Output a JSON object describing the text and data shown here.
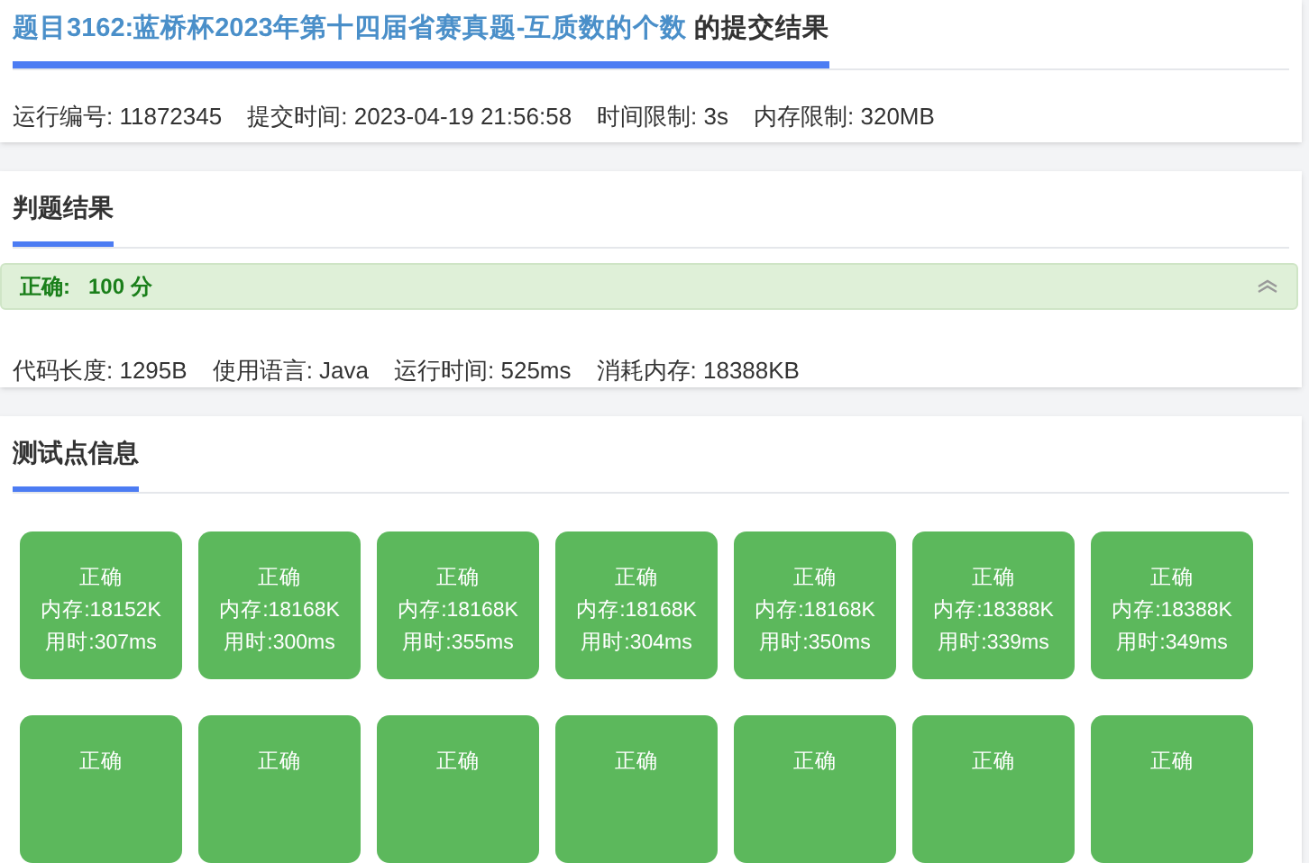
{
  "submission": {
    "problem_title": "题目3162:蓝桥杯2023年第十四届省赛真题-互质数的个数",
    "title_suffix": "的提交结果",
    "info": [
      "运行编号: 11872345",
      "提交时间: 2023-04-19 21:56:58",
      "时间限制: 3s",
      "内存限制: 320MB"
    ]
  },
  "judge": {
    "heading": "判题结果",
    "verdict_label": "正确:",
    "score": "100 分",
    "expanded": true,
    "stats": [
      "代码长度: 1295B",
      "使用语言: Java",
      "运行时间: 525ms",
      "消耗内存: 18388KB"
    ]
  },
  "tests": {
    "heading": "测试点信息",
    "cases": [
      {
        "status": "正确",
        "memory": "内存:18152K",
        "time": "用时:307ms"
      },
      {
        "status": "正确",
        "memory": "内存:18168K",
        "time": "用时:300ms"
      },
      {
        "status": "正确",
        "memory": "内存:18168K",
        "time": "用时:355ms"
      },
      {
        "status": "正确",
        "memory": "内存:18168K",
        "time": "用时:304ms"
      },
      {
        "status": "正确",
        "memory": "内存:18168K",
        "time": "用时:350ms"
      },
      {
        "status": "正确",
        "memory": "内存:18388K",
        "time": "用时:339ms"
      },
      {
        "status": "正确",
        "memory": "内存:18388K",
        "time": "用时:349ms"
      },
      {
        "status": "正确"
      },
      {
        "status": "正确"
      },
      {
        "status": "正确"
      },
      {
        "status": "正确"
      },
      {
        "status": "正确"
      },
      {
        "status": "正确"
      },
      {
        "status": "正确"
      }
    ]
  }
}
